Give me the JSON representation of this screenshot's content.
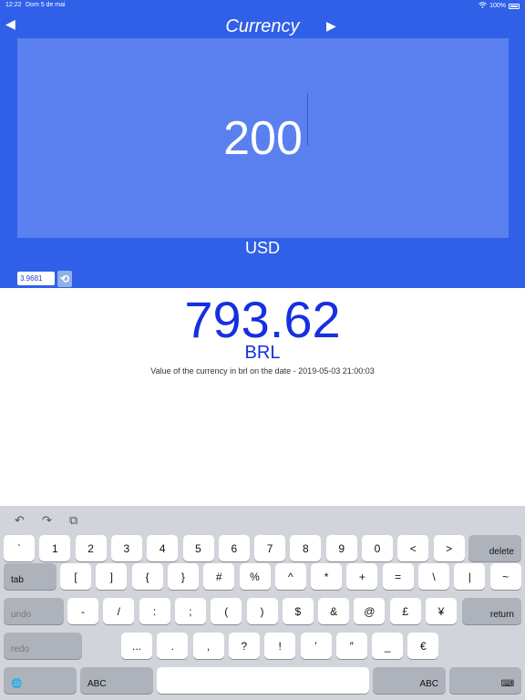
{
  "status": {
    "time": "12:22",
    "date": "Dom 5 de mai",
    "battery": "100%",
    "wifi_icon": "wifi-icon",
    "battery_icon": "battery-icon"
  },
  "header": {
    "title": "Currency",
    "prev_icon": "◀",
    "next_icon": "▶"
  },
  "converter": {
    "amount": "200",
    "from_code": "USD",
    "rate": "3.9681",
    "refresh_icon": "⟲",
    "result": "793.62",
    "to_code": "BRL",
    "note": "Value of the currency in brl on the date - 2019-05-03 21:00:03"
  },
  "colors": {
    "header_bg": "#3060e8",
    "amount_bg": "#5a80f0",
    "result_text": "#1530e0"
  },
  "keyboard": {
    "tools": {
      "undo_icon": "↶",
      "redo_icon": "↷",
      "paste_icon": "⧉"
    },
    "row1": [
      "`",
      "1",
      "2",
      "3",
      "4",
      "5",
      "6",
      "7",
      "8",
      "9",
      "0",
      "<",
      ">"
    ],
    "row1_func": "delete",
    "row2_func": "tab",
    "row2": [
      "[",
      "]",
      "{",
      "}",
      "#",
      "%",
      "^",
      "*",
      "+",
      "=",
      "\\",
      "|",
      "~"
    ],
    "row3_func": "undo",
    "row3": [
      "-",
      "/",
      ":",
      ";",
      "(",
      ")",
      "$",
      "&",
      "@",
      "£",
      "¥"
    ],
    "row3_return": "return",
    "row4_func": "redo",
    "row4": [
      "...",
      ".",
      ",",
      "?",
      "!",
      "’",
      "″",
      "_",
      "€"
    ],
    "row5_globe": "🌐",
    "row5_abc_left": "ABC",
    "row5_abc_right": "ABC",
    "row5_hide": "⌨"
  }
}
